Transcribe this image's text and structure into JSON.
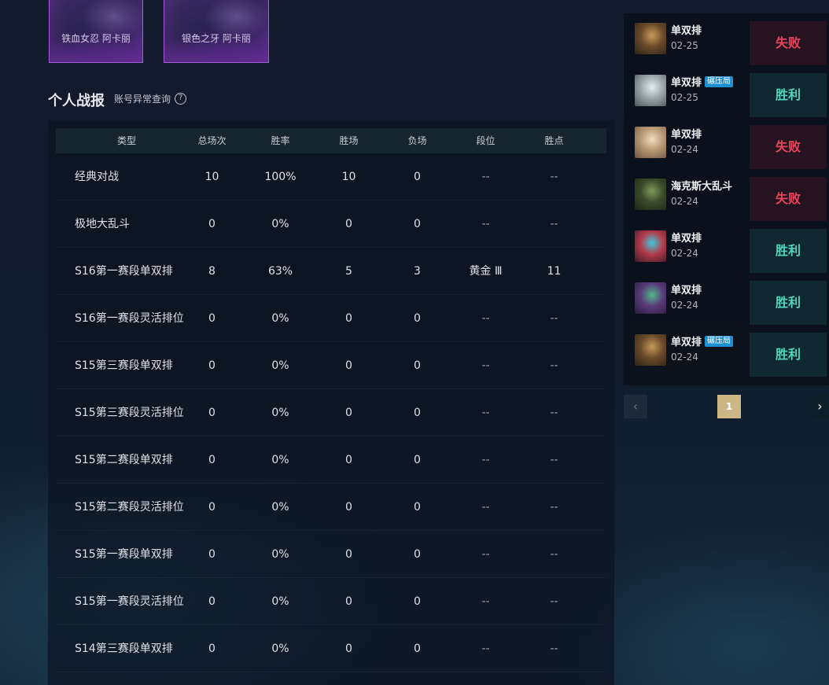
{
  "skins": [
    {
      "name": "铁血女忍 阿卡丽"
    },
    {
      "name": "银色之牙 阿卡丽"
    }
  ],
  "section": {
    "title": "个人战报",
    "abnormal_query": "账号异常查询",
    "help_icon": "?"
  },
  "stats": {
    "headers": [
      "类型",
      "总场次",
      "胜率",
      "胜场",
      "负场",
      "段位",
      "胜点"
    ],
    "rows": [
      {
        "type": "经典对战",
        "total": "10",
        "rate": "100%",
        "win": "10",
        "loss": "0",
        "rank": "--",
        "lp": "--"
      },
      {
        "type": "极地大乱斗",
        "total": "0",
        "rate": "0%",
        "win": "0",
        "loss": "0",
        "rank": "--",
        "lp": "--"
      },
      {
        "type": "S16第一赛段单双排",
        "total": "8",
        "rate": "63%",
        "win": "5",
        "loss": "3",
        "rank": "黄金 Ⅲ",
        "lp": "11"
      },
      {
        "type": "S16第一赛段灵活排位",
        "total": "0",
        "rate": "0%",
        "win": "0",
        "loss": "0",
        "rank": "--",
        "lp": "--"
      },
      {
        "type": "S15第三赛段单双排",
        "total": "0",
        "rate": "0%",
        "win": "0",
        "loss": "0",
        "rank": "--",
        "lp": "--"
      },
      {
        "type": "S15第三赛段灵活排位",
        "total": "0",
        "rate": "0%",
        "win": "0",
        "loss": "0",
        "rank": "--",
        "lp": "--"
      },
      {
        "type": "S15第二赛段单双排",
        "total": "0",
        "rate": "0%",
        "win": "0",
        "loss": "0",
        "rank": "--",
        "lp": "--"
      },
      {
        "type": "S15第二赛段灵活排位",
        "total": "0",
        "rate": "0%",
        "win": "0",
        "loss": "0",
        "rank": "--",
        "lp": "--"
      },
      {
        "type": "S15第一赛段单双排",
        "total": "0",
        "rate": "0%",
        "win": "0",
        "loss": "0",
        "rank": "--",
        "lp": "--"
      },
      {
        "type": "S15第一赛段灵活排位",
        "total": "0",
        "rate": "0%",
        "win": "0",
        "loss": "0",
        "rank": "--",
        "lp": "--"
      },
      {
        "type": "S14第三赛段单双排",
        "total": "0",
        "rate": "0%",
        "win": "0",
        "loss": "0",
        "rank": "--",
        "lp": "--"
      }
    ]
  },
  "matches": [
    {
      "mode": "单双排",
      "badge": "",
      "date": "02-25",
      "result": "失败",
      "outcome": "lose",
      "avatar_colors": [
        "#6b4a2a",
        "#c89a5a",
        "#2a2218"
      ]
    },
    {
      "mode": "单双排",
      "badge": "碾压局",
      "date": "02-25",
      "result": "胜利",
      "outcome": "win",
      "avatar_colors": [
        "#9aa5a8",
        "#e6ecee",
        "#4b5558"
      ]
    },
    {
      "mode": "单双排",
      "badge": "",
      "date": "02-24",
      "result": "失败",
      "outcome": "lose",
      "avatar_colors": [
        "#b89874",
        "#f0dcc0",
        "#6a5440"
      ]
    },
    {
      "mode": "海克斯大乱斗",
      "badge": "",
      "date": "02-24",
      "result": "失败",
      "outcome": "lose",
      "avatar_colors": [
        "#3a4a2a",
        "#7f9a5a",
        "#1f2618"
      ]
    },
    {
      "mode": "单双排",
      "badge": "",
      "date": "02-24",
      "result": "胜利",
      "outcome": "win",
      "avatar_colors": [
        "#b43a4a",
        "#3fc8d8",
        "#3a1a28"
      ]
    },
    {
      "mode": "单双排",
      "badge": "",
      "date": "02-24",
      "result": "胜利",
      "outcome": "win",
      "avatar_colors": [
        "#5a3a7a",
        "#4fb88a",
        "#2a1a3a"
      ]
    },
    {
      "mode": "单双排",
      "badge": "碾压局",
      "date": "02-24",
      "result": "胜利",
      "outcome": "win",
      "avatar_colors": [
        "#6b4a2a",
        "#c89a5a",
        "#2a2218"
      ]
    }
  ],
  "pager": {
    "prev": "‹",
    "current": "1",
    "next": "›"
  }
}
